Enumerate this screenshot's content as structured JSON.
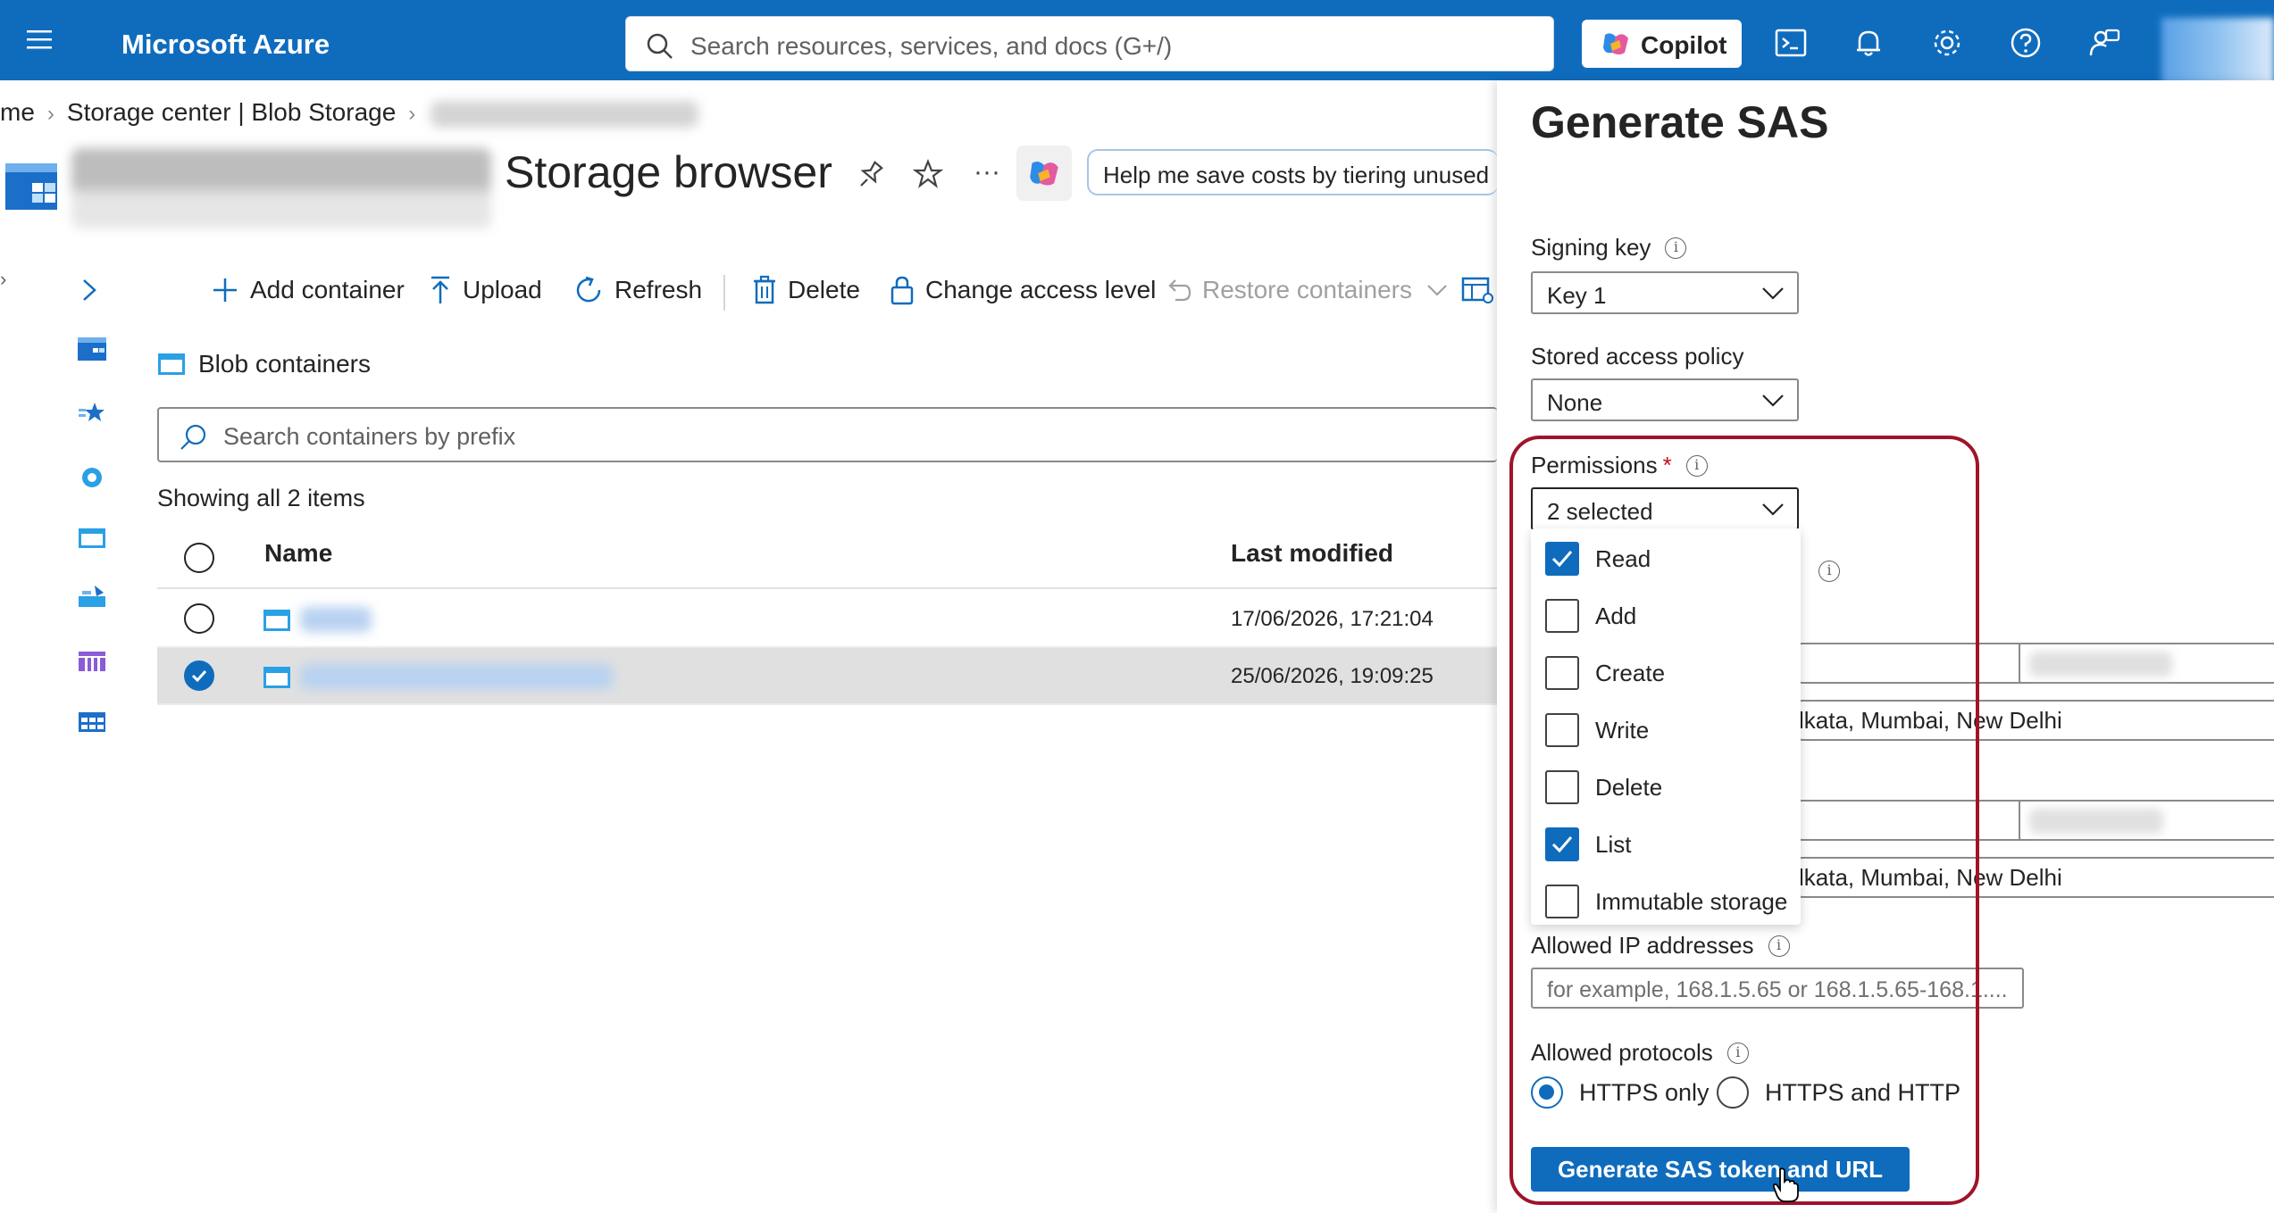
{
  "topbar": {
    "brand": "Microsoft Azure",
    "search_placeholder": "Search resources, services, and docs (G+/)",
    "copilot_label": "Copilot",
    "icons": [
      "menu-icon",
      "cloud-shell-icon",
      "bell-icon",
      "gear-icon",
      "help-icon",
      "feedback-icon"
    ]
  },
  "breadcrumb": {
    "items": [
      "me",
      "Storage center | Blob Storage"
    ]
  },
  "header": {
    "title": "Storage browser",
    "help_prompt": "Help me save costs by tiering unused b"
  },
  "toolbar": {
    "add_container": "Add container",
    "upload": "Upload",
    "refresh": "Refresh",
    "delete": "Delete",
    "change_access": "Change access level",
    "restore": "Restore containers"
  },
  "containers": {
    "section_label": "Blob containers",
    "search_placeholder": "Search containers by prefix",
    "count_text": "Showing all 2 items",
    "columns": {
      "name": "Name",
      "last_modified": "Last modified"
    },
    "rows": [
      {
        "last_modified": "17/06/2026, 17:21:04",
        "selected": false
      },
      {
        "last_modified": "25/06/2026, 19:09:25",
        "selected": true
      }
    ]
  },
  "sas_panel": {
    "title": "Generate SAS",
    "signing_key_label": "Signing key",
    "signing_key_value": "Key 1",
    "stored_policy_label": "Stored access policy",
    "stored_policy_value": "None",
    "permissions_label": "Permissions",
    "required_mark": "*",
    "permissions_value": "2 selected",
    "permissions_options": [
      {
        "label": "Read",
        "checked": true
      },
      {
        "label": "Add",
        "checked": false
      },
      {
        "label": "Create",
        "checked": false
      },
      {
        "label": "Write",
        "checked": false
      },
      {
        "label": "Delete",
        "checked": false
      },
      {
        "label": "List",
        "checked": true
      },
      {
        "label": "Immutable storage",
        "checked": false
      }
    ],
    "timezone_partial_1": "lkata, Mumbai, New Delhi",
    "timezone_partial_2": "lkata, Mumbai, New Delhi",
    "allowed_ip_label": "Allowed IP addresses",
    "allowed_ip_placeholder": "for example, 168.1.5.65 or 168.1.5.65-168.1....",
    "allowed_protocols_label": "Allowed protocols",
    "protocol_https_only": "HTTPS only",
    "protocol_https_http": "HTTPS and HTTP",
    "protocol_selected": "HTTPS only",
    "generate_button": "Generate SAS token and URL"
  },
  "colors": {
    "accent": "#0f6cbd",
    "highlight": "#a0132a"
  }
}
